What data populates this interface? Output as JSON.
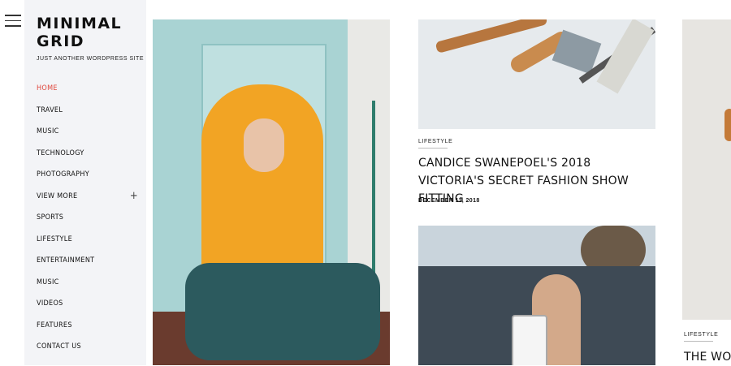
{
  "site": {
    "title": "MINIMAL GRID",
    "tagline": "JUST ANOTHER WORDPRESS SITE"
  },
  "nav": {
    "items": [
      {
        "label": "HOME",
        "active": true
      },
      {
        "label": "TRAVEL"
      },
      {
        "label": "MUSIC"
      },
      {
        "label": "TECHNOLOGY"
      },
      {
        "label": "PHOTOGRAPHY"
      },
      {
        "label": "VIEW MORE",
        "expandable": true
      },
      {
        "label": "SPORTS"
      },
      {
        "label": "LIFESTYLE"
      },
      {
        "label": "ENTERTAINMENT"
      },
      {
        "label": "MUSIC"
      },
      {
        "label": "VIDEOS"
      },
      {
        "label": "FEATURES"
      },
      {
        "label": "CONTACT US"
      }
    ],
    "expand_symbol": "+"
  },
  "posts": [
    {
      "category": "LIFESTYLE",
      "title": "CANDICE SWANEPOEL'S 2018 VICTORIA'S SECRET FASHION SHOW FITTING",
      "date": "DECEMBER 11, 2018"
    },
    {
      "category": "LIFESTYLE",
      "title": "THE WORL"
    }
  ],
  "colors": {
    "accent": "#e0483e",
    "sidebar_bg": "#f3f4f7"
  },
  "icons": {
    "menu": "hamburger-menu-icon"
  }
}
